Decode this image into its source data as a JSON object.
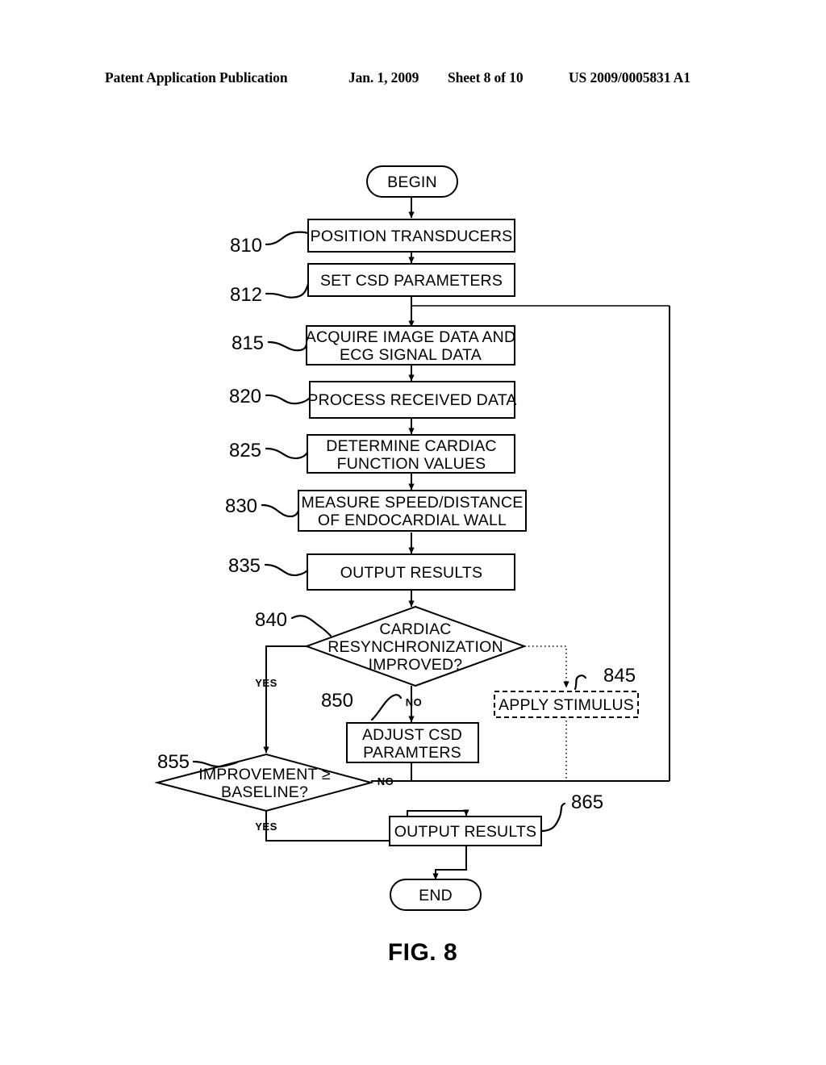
{
  "header": {
    "title": "Patent Application Publication",
    "date": "Jan. 1, 2009",
    "sheet": "Sheet 8 of 10",
    "pub_number": "US 2009/0005831 A1"
  },
  "figure": {
    "caption": "FIG. 8"
  },
  "nodes": {
    "begin": {
      "ref": "",
      "label": "BEGIN",
      "shape": "terminator"
    },
    "n810": {
      "ref": "810",
      "label": "POSITION TRANSDUCERS",
      "shape": "process"
    },
    "n812": {
      "ref": "812",
      "label": "SET CSD PARAMETERS",
      "shape": "process"
    },
    "n815": {
      "ref": "815",
      "label_line1": "ACQUIRE IMAGE DATA AND",
      "label_line2": "ECG SIGNAL DATA",
      "shape": "process"
    },
    "n820": {
      "ref": "820",
      "label": "PROCESS RECEIVED DATA",
      "shape": "process"
    },
    "n825": {
      "ref": "825",
      "label_line1": "DETERMINE CARDIAC",
      "label_line2": "FUNCTION VALUES",
      "shape": "process"
    },
    "n830": {
      "ref": "830",
      "label_line1": "MEASURE SPEED/DISTANCE",
      "label_line2": "OF ENDOCARDIAL WALL",
      "shape": "process"
    },
    "n835": {
      "ref": "835",
      "label": "OUTPUT RESULTS",
      "shape": "process"
    },
    "n840": {
      "ref": "840",
      "label_line1": "CARDIAC",
      "label_line2": "RESYNCHRONIZATION",
      "label_line3": "IMPROVED?",
      "shape": "decision"
    },
    "n845": {
      "ref": "845",
      "label": "APPLY STIMULUS",
      "shape": "process-dashed"
    },
    "n850": {
      "ref": "850",
      "label_line1": "ADJUST CSD",
      "label_line2": "PARAMTERS",
      "shape": "process"
    },
    "n855": {
      "ref": "855",
      "label_line1": "IMPROVEMENT ≥",
      "label_line2": "BASELINE?",
      "shape": "decision"
    },
    "n865": {
      "ref": "865",
      "label": "OUTPUT RESULTS",
      "shape": "process"
    },
    "end": {
      "ref": "",
      "label": "END",
      "shape": "terminator"
    }
  },
  "edge_labels": {
    "yes_840": "YES",
    "no_840": "NO",
    "yes_855": "YES",
    "no_855": "NO"
  },
  "colors": {
    "ink": "#000000",
    "paper": "#ffffff"
  }
}
